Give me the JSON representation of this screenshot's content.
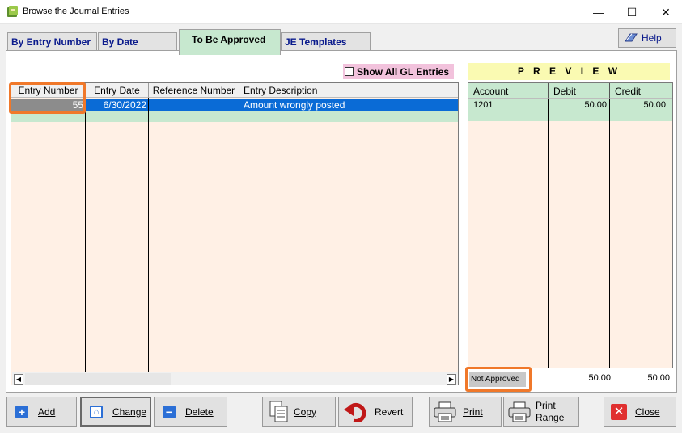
{
  "window": {
    "title": "Browse the Journal Entries",
    "controls": {
      "minimize": "—",
      "maximize": "☐",
      "close": "✕"
    }
  },
  "tabs": {
    "entry_number": "By Entry Number",
    "date": "By Date",
    "to_be_approved": "To Be Approved",
    "templates": "JE Templates"
  },
  "help": {
    "label": "Help"
  },
  "show_all": {
    "label": "Show All GL Entries",
    "checked": false
  },
  "grid": {
    "headers": [
      "Entry Number",
      "Entry Date",
      "Reference Number",
      "Entry Description"
    ],
    "rows": [
      {
        "entry_number": "55",
        "entry_date": "6/30/2022",
        "reference_number": "",
        "description": "Amount wrongly posted"
      }
    ]
  },
  "preview": {
    "title": "P R E V I E W",
    "headers": [
      "Account",
      "Debit",
      "Credit"
    ],
    "rows": [
      {
        "account": "1201",
        "debit": "50.00",
        "credit": "50.00"
      }
    ],
    "status": "Not Approved",
    "total_debit": "50.00",
    "total_credit": "50.00"
  },
  "toolbar": {
    "add": "Add",
    "change": "Change",
    "delete": "Delete",
    "copy": "Copy",
    "revert": "Revert",
    "print": "Print",
    "print_range_1": "Print",
    "print_range_2": "Range",
    "close": "Close"
  },
  "colors": {
    "accent_tab": "#c7e8cf",
    "grid_bg": "#fff0e5",
    "selection": "#0a6bd6",
    "highlight": "#f0782a"
  }
}
